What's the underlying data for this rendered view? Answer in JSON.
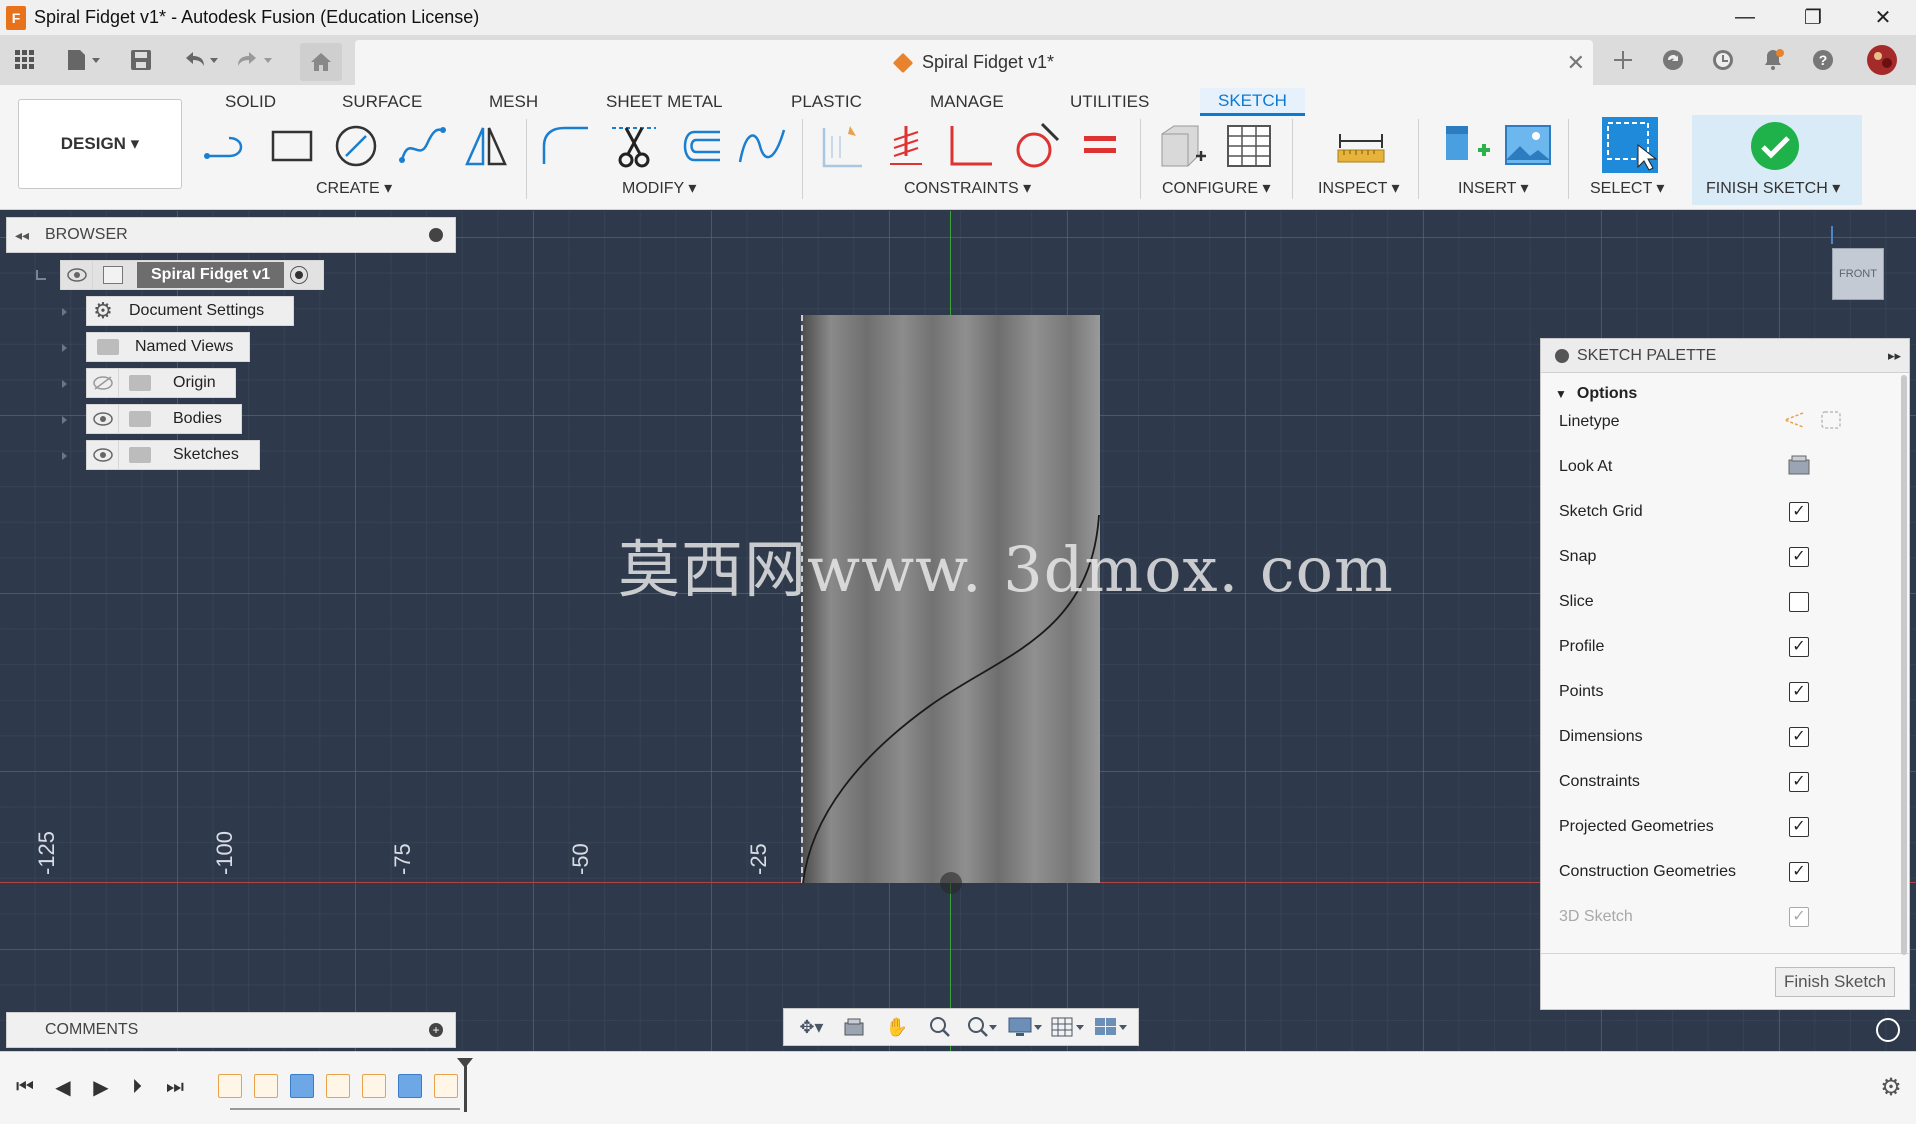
{
  "window": {
    "title": "Spiral Fidget v1* - Autodesk Fusion (Education License)",
    "app_icon_letter": "F",
    "minimize": "—",
    "maximize": "❐",
    "close": "✕"
  },
  "doc_tab": {
    "title": "Spiral Fidget v1*",
    "close": "✕"
  },
  "ribbon": {
    "workspace": "DESIGN ▾",
    "tabs": [
      "SOLID",
      "SURFACE",
      "MESH",
      "SHEET METAL",
      "PLASTIC",
      "MANAGE",
      "UTILITIES",
      "SKETCH"
    ],
    "active_tab": "SKETCH",
    "groups": {
      "create": "CREATE ▾",
      "modify": "MODIFY ▾",
      "constraints": "CONSTRAINTS ▾",
      "configure": "CONFIGURE ▾",
      "inspect": "INSPECT ▾",
      "insert": "INSERT ▾",
      "select": "SELECT ▾",
      "finish": "FINISH SKETCH ▾"
    }
  },
  "browser": {
    "title": "BROWSER",
    "root": "Spiral Fidget v1",
    "items": [
      "Document Settings",
      "Named Views",
      "Origin",
      "Bodies",
      "Sketches"
    ]
  },
  "canvas": {
    "ticks": [
      "-125",
      "-100",
      "-75",
      "-50",
      "-25"
    ],
    "watermark": "莫西网www. 3dmox. com",
    "viewcube": "FRONT"
  },
  "palette": {
    "title": "SKETCH PALETTE",
    "section": "Options",
    "rows": [
      {
        "label": "Linetype",
        "type": "icons"
      },
      {
        "label": "Look At",
        "type": "icon"
      },
      {
        "label": "Sketch Grid",
        "checked": true
      },
      {
        "label": "Snap",
        "checked": true
      },
      {
        "label": "Slice",
        "checked": false
      },
      {
        "label": "Profile",
        "checked": true
      },
      {
        "label": "Points",
        "checked": true
      },
      {
        "label": "Dimensions",
        "checked": true
      },
      {
        "label": "Constraints",
        "checked": true
      },
      {
        "label": "Projected Geometries",
        "checked": true
      },
      {
        "label": "Construction Geometries",
        "checked": true
      },
      {
        "label": "3D Sketch",
        "checked": true,
        "disabled": true
      }
    ],
    "finish_button": "Finish Sketch"
  },
  "comments": {
    "title": "COMMENTS"
  },
  "colors": {
    "accent": "#0a7bd4",
    "canvas": "#2e3a4c",
    "finish_green": "#1fb24a"
  }
}
